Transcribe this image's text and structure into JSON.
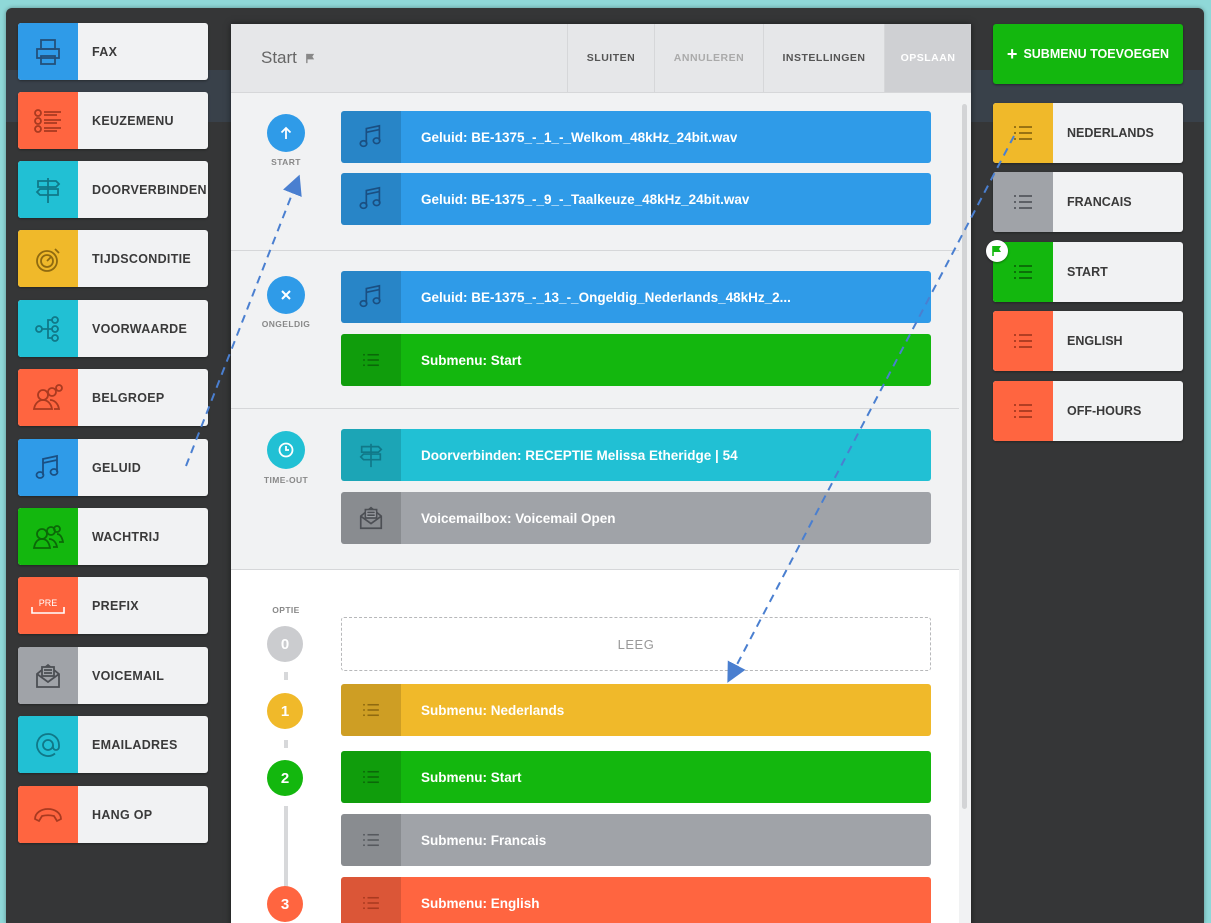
{
  "palette": [
    {
      "label": "FAX",
      "color": "#2f9be8",
      "icon": "fax-icon"
    },
    {
      "label": "KEUZEMENU",
      "color": "#ff6540",
      "icon": "menu-icon"
    },
    {
      "label": "DOORVERBINDEN",
      "color": "#21c0d4",
      "icon": "signpost-icon"
    },
    {
      "label": "TIJDSCONDITIE",
      "color": "#f0b92a",
      "icon": "timer-icon"
    },
    {
      "label": "VOORWAARDE",
      "color": "#21c0d4",
      "icon": "branch-icon"
    },
    {
      "label": "BELGROEP",
      "color": "#ff6540",
      "icon": "group-icon"
    },
    {
      "label": "GELUID",
      "color": "#2f9be8",
      "icon": "music-note-icon"
    },
    {
      "label": "WACHTRIJ",
      "color": "#13b70e",
      "icon": "queue-icon"
    },
    {
      "label": "PREFIX",
      "color": "#ff6540",
      "icon": "prefix-icon",
      "icon_text": "PRE"
    },
    {
      "label": "VOICEMAIL",
      "color": "#a0a3a8",
      "icon": "envelope-icon"
    },
    {
      "label": "EMAILADRES",
      "color": "#21c0d4",
      "icon": "at-icon"
    },
    {
      "label": "HANG OP",
      "color": "#ff6540",
      "icon": "hangup-icon"
    }
  ],
  "header": {
    "title": "Start",
    "buttons": [
      "SLUITEN",
      "ANNULEREN",
      "INSTELLINGEN",
      "OPSLAAN"
    ]
  },
  "events": {
    "start": {
      "label": "START",
      "rows": [
        "Geluid: BE-1375_-_1_-_Welkom_48kHz_24bit.wav",
        "Geluid: BE-1375_-_9_-_Taalkeuze_48kHz_24bit.wav"
      ]
    },
    "invalid": {
      "label": "ONGELDIG",
      "rows": [
        "Geluid: BE-1375_-_13_-_Ongeldig_Nederlands_48kHz_2...",
        "Submenu: Start"
      ]
    },
    "timeout": {
      "label": "TIME-OUT",
      "rows": [
        "Doorverbinden: RECEPTIE Melissa Etheridge | 54",
        "Voicemailbox: Voicemail Open"
      ]
    }
  },
  "options": {
    "label": "OPTIE",
    "empty_label": "LEEG",
    "items": [
      {
        "number": "0",
        "text": ""
      },
      {
        "number": "1",
        "text": "Submenu: Nederlands"
      },
      {
        "number": "2",
        "text": "Submenu: Start"
      },
      {
        "number": "",
        "text": "Submenu: Francais"
      },
      {
        "number": "3",
        "text": "Submenu: English"
      }
    ]
  },
  "right": {
    "add_button": "SUBMENU TOEVOEGEN",
    "submenus": [
      {
        "label": "NEDERLANDS",
        "color": "#f0b92a"
      },
      {
        "label": "FRANCAIS",
        "color": "#a0a3a8"
      },
      {
        "label": "START",
        "color": "#13b70e"
      },
      {
        "label": "ENGLISH",
        "color": "#ff6540"
      },
      {
        "label": "OFF-HOURS",
        "color": "#ff6540"
      }
    ]
  },
  "colors": {
    "blue": "#2f9be8",
    "green": "#13b70e",
    "cyan": "#21c0d4",
    "gray": "#a0a3a8",
    "yellow": "#f0b92a",
    "orange": "#ff6540",
    "dash": "#4a7fd0"
  }
}
